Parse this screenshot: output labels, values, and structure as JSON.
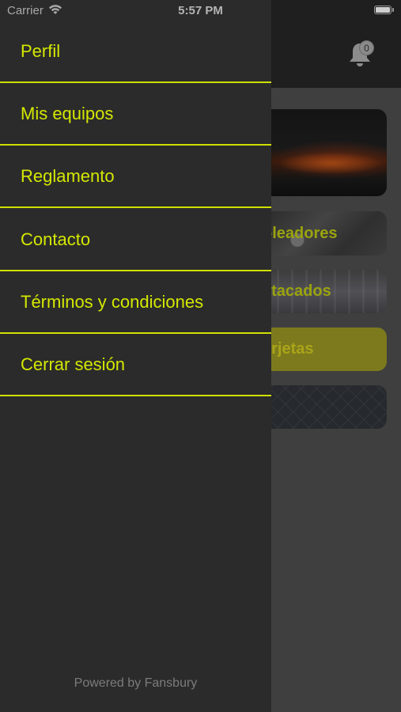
{
  "status_bar": {
    "carrier": "Carrier",
    "time": "5:57 PM"
  },
  "header": {
    "notification_count": "0"
  },
  "background_cards": [
    {
      "label": ""
    },
    {
      "label": "oleadores"
    },
    {
      "label": "stacados"
    },
    {
      "label": "arjetas"
    },
    {
      "label": ""
    }
  ],
  "menu": {
    "items": [
      {
        "label": "Perfil"
      },
      {
        "label": "Mis equipos"
      },
      {
        "label": "Reglamento"
      },
      {
        "label": "Contacto"
      },
      {
        "label": "Términos y condiciones"
      },
      {
        "label": "Cerrar sesión"
      }
    ],
    "footer": "Powered by Fansbury"
  },
  "colors": {
    "accent": "#d4e800",
    "drawer_bg": "#2b2b2b",
    "header_bg": "#1f1f1f"
  }
}
